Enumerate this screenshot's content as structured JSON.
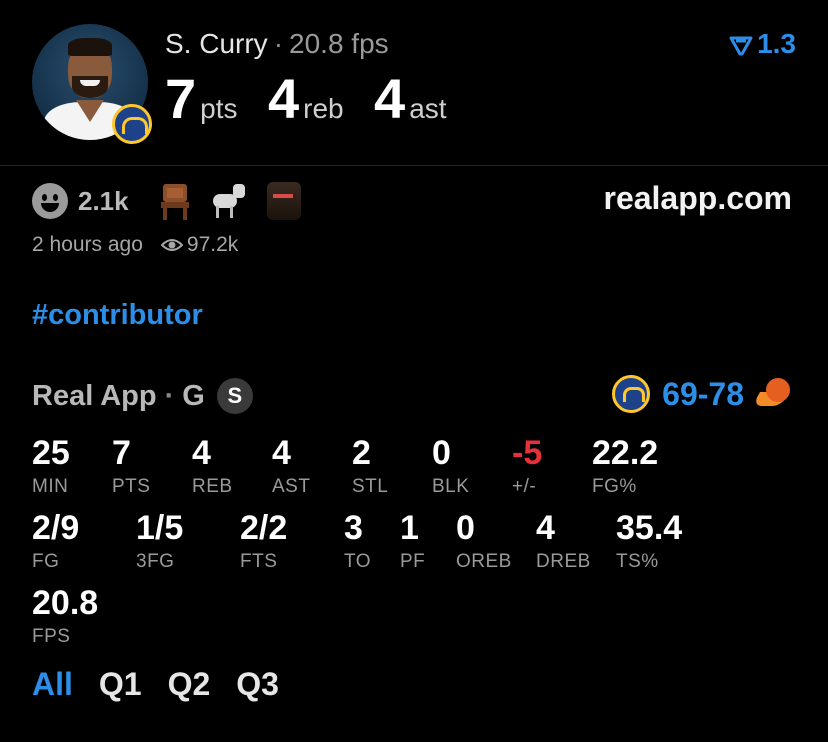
{
  "header": {
    "player_name": "S. Curry",
    "separator": "·",
    "fps_text": "20.8 fps",
    "pts_value": "7",
    "pts_unit": "pts",
    "reb_value": "4",
    "reb_unit": "reb",
    "ast_value": "4",
    "ast_unit": "ast",
    "version": "1.3",
    "accent_color": "#2d8ee8"
  },
  "post": {
    "reaction_count": "2.1k",
    "reaction_icons": [
      "smiley-icon",
      "chair-icon",
      "goat-icon",
      "fan-avatar-icon"
    ],
    "site": "realapp.com",
    "time_ago": "2 hours ago",
    "views": "97.2k",
    "hashtag": "#contributor"
  },
  "game": {
    "app_name": "Real App",
    "separator": "·",
    "position": "G",
    "badge": "S",
    "score_home": "69",
    "score_dash": "-",
    "score_away": "78"
  },
  "stats_rows": [
    [
      {
        "value": "25",
        "label": "MIN"
      },
      {
        "value": "7",
        "label": "PTS"
      },
      {
        "value": "4",
        "label": "REB"
      },
      {
        "value": "4",
        "label": "AST"
      },
      {
        "value": "2",
        "label": "STL"
      },
      {
        "value": "0",
        "label": "BLK"
      },
      {
        "value": "-5",
        "label": "+/-"
      },
      {
        "value": "22.2",
        "label": "FG%"
      }
    ],
    [
      {
        "value": "2/9",
        "label": "FG"
      },
      {
        "value": "1/5",
        "label": "3FG"
      },
      {
        "value": "2/2",
        "label": "FTS"
      },
      {
        "value": "3",
        "label": "TO"
      },
      {
        "value": "1",
        "label": "PF"
      },
      {
        "value": "0",
        "label": "OREB"
      },
      {
        "value": "4",
        "label": "DREB"
      },
      {
        "value": "35.4",
        "label": "TS%"
      }
    ],
    [
      {
        "value": "20.8",
        "label": "FPS"
      }
    ]
  ],
  "tabs": [
    "All",
    "Q1",
    "Q2",
    "Q3"
  ],
  "active_tab": "All"
}
